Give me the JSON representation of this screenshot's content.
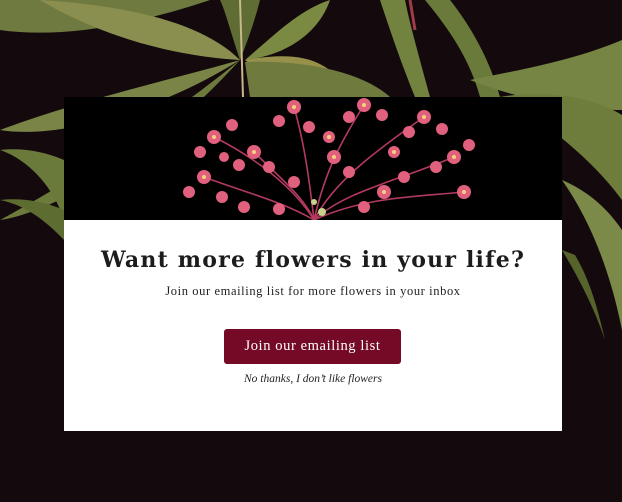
{
  "colors": {
    "page_background": "#140a0d",
    "modal_background": "#ffffff",
    "hero_background": "#000000",
    "cta_background": "#740a26",
    "cta_text": "#ffffff",
    "leaf_green": "#7f8a48",
    "flower_pink": "#e0607e"
  },
  "background": {
    "icon": "leaf-icon"
  },
  "modal": {
    "hero": {
      "icon": "flower-illustration-icon"
    },
    "title": "Want more flowers in your life?",
    "subtitle": "Join our emailing list for more flowers in your inbox",
    "cta_label": "Join our emailing list",
    "decline_label": "No thanks, I don’t like flowers"
  }
}
